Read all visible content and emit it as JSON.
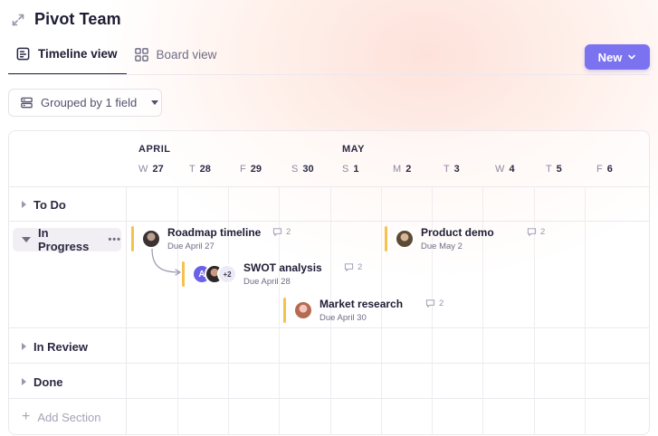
{
  "header": {
    "title": "Pivot Team",
    "expand_icon": "expand-arrows-icon"
  },
  "tabs": [
    {
      "label": "Timeline view",
      "icon": "timeline-icon",
      "active": true
    },
    {
      "label": "Board view",
      "icon": "grid-icon",
      "active": false
    }
  ],
  "new_button": {
    "label": "New",
    "icon": "chevron-down-icon",
    "color": "#7b72f0"
  },
  "group_button": {
    "label": "Grouped by 1 field",
    "icon": "database-icon"
  },
  "timeline": {
    "months": [
      "APRIL",
      "MAY"
    ],
    "days": [
      {
        "dow": "W",
        "num": "27"
      },
      {
        "dow": "T",
        "num": "28"
      },
      {
        "dow": "F",
        "num": "29"
      },
      {
        "dow": "S",
        "num": "30"
      },
      {
        "dow": "S",
        "num": "1"
      },
      {
        "dow": "M",
        "num": "2"
      },
      {
        "dow": "T",
        "num": "3"
      },
      {
        "dow": "W",
        "num": "4"
      },
      {
        "dow": "T",
        "num": "5"
      },
      {
        "dow": "F",
        "num": "6"
      }
    ]
  },
  "sections": [
    {
      "label": "To Do",
      "expanded": false
    },
    {
      "label": "In Progress",
      "expanded": true,
      "more": "•••"
    },
    {
      "label": "In Review",
      "expanded": false
    },
    {
      "label": "Done",
      "expanded": false
    }
  ],
  "add_section": {
    "icon": "+",
    "label": "Add Section"
  },
  "tasks": [
    {
      "name": "Roadmap timeline",
      "due": "Due April 27",
      "comments": "2",
      "avatars": [
        "avatar"
      ]
    },
    {
      "name": "SWOT analysis",
      "due": "Due April 28",
      "comments": "2",
      "avatars": [
        "A",
        "avatar",
        "+2"
      ]
    },
    {
      "name": "Market research",
      "due": "Due April 30",
      "comments": "2",
      "avatars": [
        "avatar"
      ]
    },
    {
      "name": "Product demo",
      "due": "Due May 2",
      "comments": "2",
      "avatars": [
        "avatar"
      ]
    }
  ],
  "colors": {
    "accent": "#7b72f0",
    "task_bar": "#f5c24d"
  }
}
